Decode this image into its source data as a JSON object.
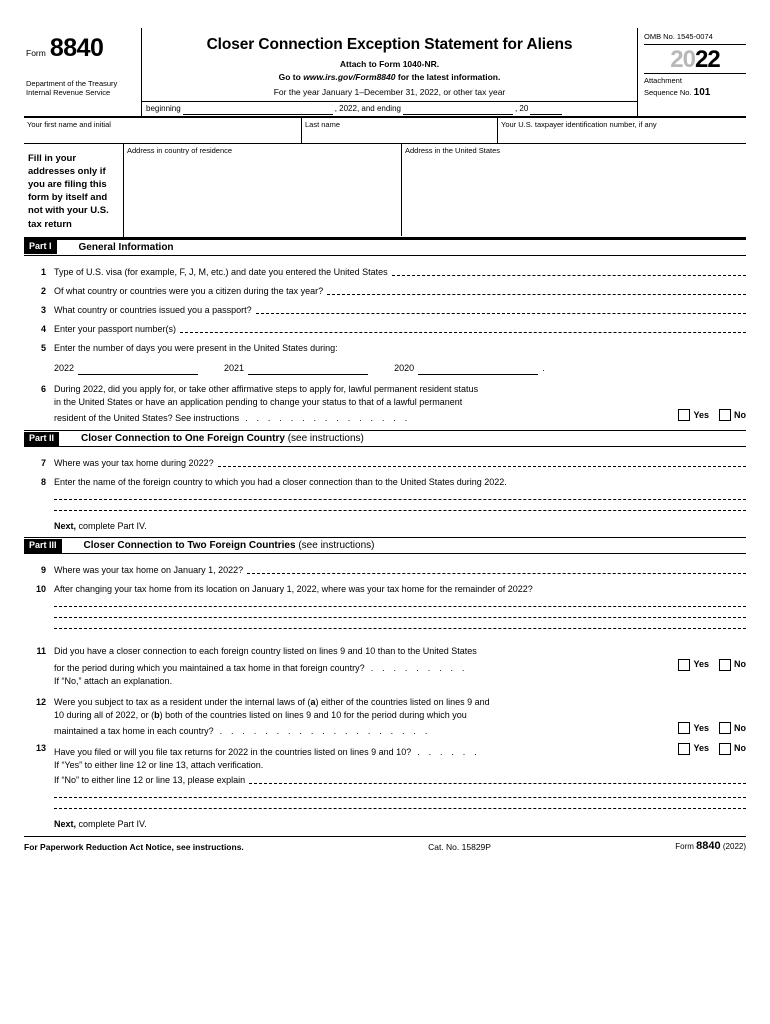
{
  "header": {
    "form_word": "Form",
    "form_number": "8840",
    "department": "Department of the Treasury\nInternal Revenue Service",
    "department_line1": "Department of the Treasury",
    "department_line2": "Internal Revenue Service",
    "title": "Closer Connection Exception Statement for Aliens",
    "attach_to": "Attach to Form 1040-NR.",
    "goto_prefix": "Go to",
    "goto_url": "www.irs.gov/Form8840",
    "goto_suffix": "for the latest information.",
    "tax_year_line": "For the year January 1–December 31, 2022, or other tax year",
    "beginning_label": "beginning",
    "ending_label": ", 2022, and ending",
    "ending_year": ", 20",
    "omb": "OMB No. 1545-0074",
    "year_grey": "20",
    "year_black": "22",
    "attachment_label_line1": "Attachment",
    "attachment_label_line2": "Sequence No.",
    "attachment_number": "101"
  },
  "name_row": {
    "first_name": "Your first name and initial",
    "last_name": "Last name",
    "tin": "Your U.S. taxpayer identification number, if any"
  },
  "address_block": {
    "fill_in_note": "Fill in your addresses only if you are filing this form by itself and not with your U.S. tax return",
    "address_residence": "Address in country of residence",
    "address_us": "Address in the United States"
  },
  "part1": {
    "label": "Part I",
    "title": "General Information",
    "lines": [
      {
        "num": "1",
        "text": "Type of U.S. visa (for example, F, J, M, etc.) and date you entered the United States"
      },
      {
        "num": "2",
        "text": "Of what country or countries were you a citizen during the tax year?"
      },
      {
        "num": "3",
        "text": "What country or countries issued you a passport?"
      },
      {
        "num": "4",
        "text": "Enter your passport number(s)"
      },
      {
        "num": "5",
        "text": "Enter the number of days you were present in the United States during:"
      }
    ],
    "line5_years": [
      "2022",
      "2021",
      "2020"
    ],
    "line6": {
      "num": "6",
      "l1": "During 2022, did you apply for, or take other affirmative steps to apply for, lawful permanent resident status",
      "l2": "in the United States or have an application pending to change your status to that of a lawful permanent",
      "l3": "resident of the United States? See instructions",
      "dots": ". . . . . . . . . . . . . . .",
      "yes": "Yes",
      "no": "No"
    }
  },
  "part2": {
    "label": "Part II",
    "title": "Closer Connection to One Foreign Country",
    "title_note": "(see instructions)",
    "lines": [
      {
        "num": "7",
        "text": "Where was your tax home during 2022?"
      },
      {
        "num": "8",
        "text": "Enter the name of the foreign country to which you had a closer connection than to the United States during 2022."
      }
    ],
    "next": "Next,",
    "next_rest": " complete Part IV."
  },
  "part3": {
    "label": "Part III",
    "title": "Closer Connection to Two Foreign Countries",
    "title_note": "(see instructions)",
    "line9": {
      "num": "9",
      "text": "Where was your tax home on January 1, 2022?"
    },
    "line10": {
      "num": "10",
      "text": "After changing your tax home from its location on January 1, 2022, where was your tax home for the remainder of 2022?"
    },
    "line11": {
      "num": "11",
      "l1": "Did you have a closer connection to each foreign country listed on lines 9 and 10 than to the United States",
      "l2": "for the period during which you maintained a tax home in that foreign country?",
      "l2dots": ". . . . . . . . .",
      "l3": "If “No,” attach an explanation.",
      "yes": "Yes",
      "no": "No"
    },
    "line12": {
      "num": "12",
      "l1_a": "Were you subject to tax as a resident under the internal laws of (",
      "l1_bold_a": "a",
      "l1_b": ") either of the countries listed on lines 9 and",
      "l2_a": "10 during all of 2022, or (",
      "l2_bold_b": "b",
      "l2_b": ") both of the countries listed on lines 9 and 10 for the period during which you",
      "l3": "maintained a tax home in each country?",
      "l3dots": ". . . . . . . . . . . . . . . . . . .",
      "yes": "Yes",
      "no": "No"
    },
    "line13": {
      "num": "13",
      "l1": "Have you filed or will you file tax returns for 2022 in the countries listed on lines 9 and 10?",
      "l1dots": ". . . . . .",
      "l2": "If “Yes” to either line 12 or line 13, attach verification.",
      "l3": "If “No” to either line 12 or line 13, please explain",
      "yes": "Yes",
      "no": "No"
    },
    "next": "Next,",
    "next_rest": " complete Part IV."
  },
  "footer": {
    "left": "For Paperwork Reduction Act Notice, see instructions.",
    "cat": "Cat. No. 15829P",
    "form_word": "Form",
    "form_number": "8840",
    "form_year": "(2022)"
  }
}
